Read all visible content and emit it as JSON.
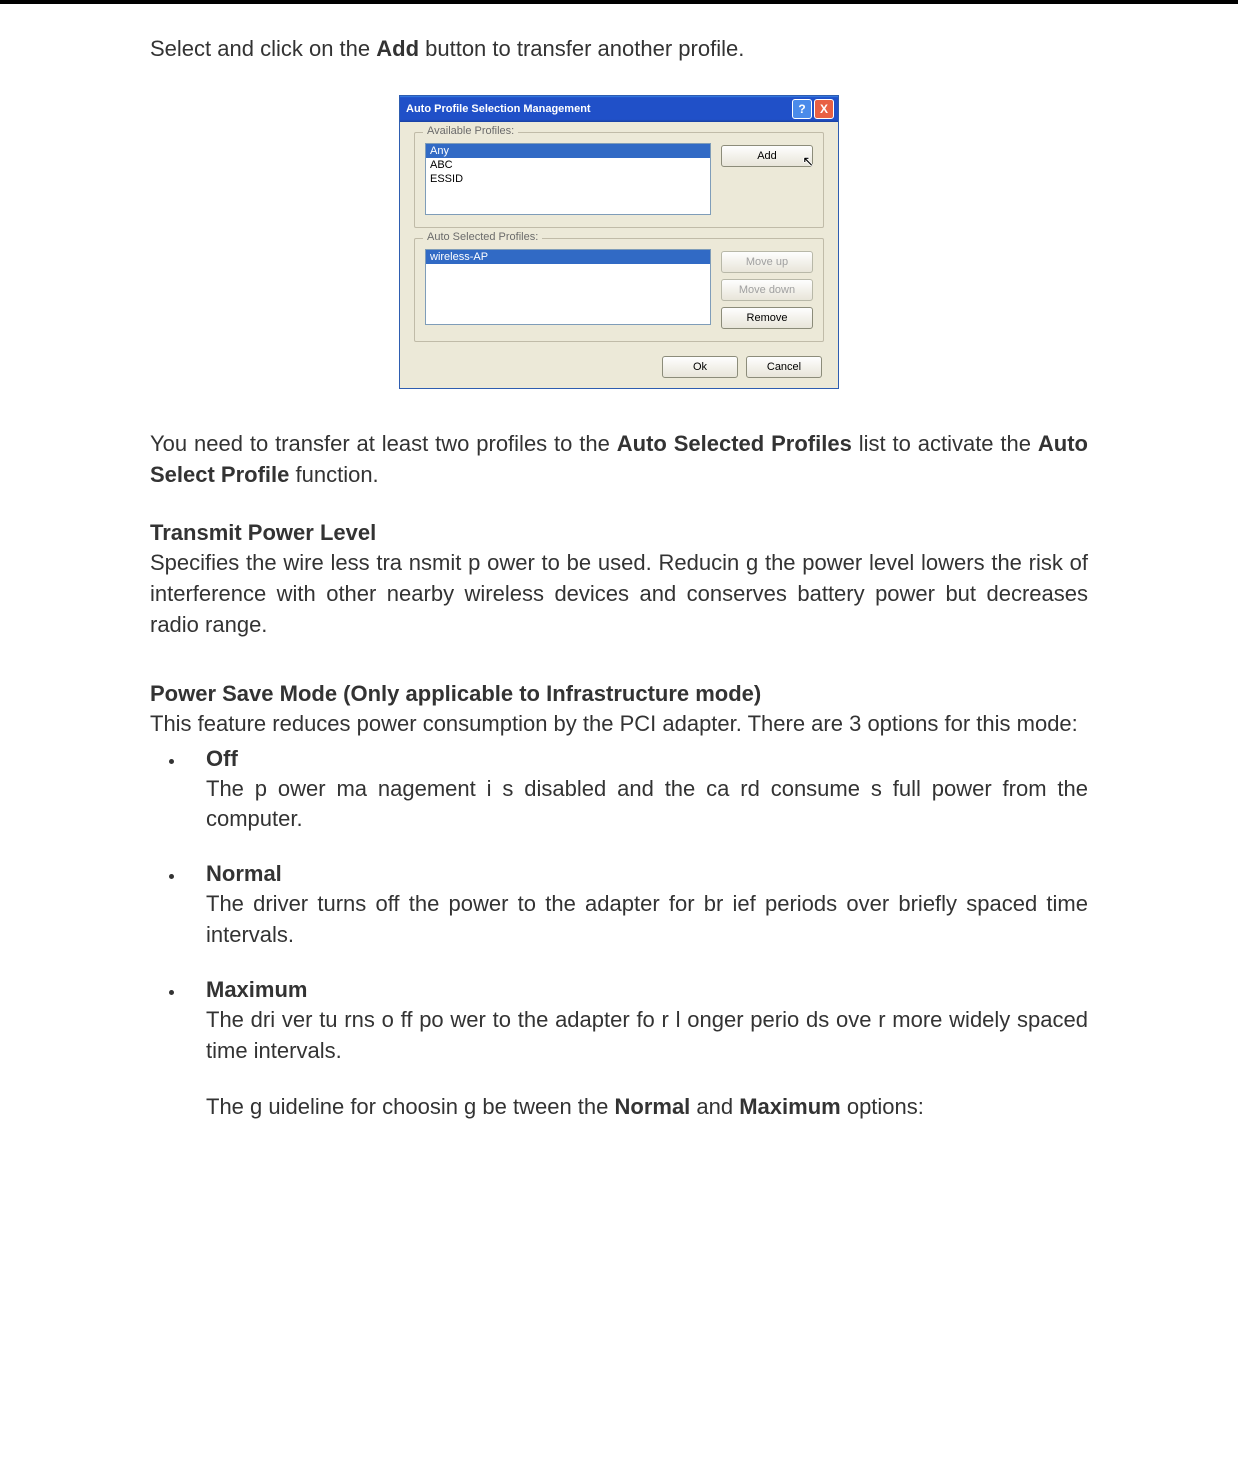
{
  "intro": {
    "pre": "Select and click on the ",
    "add_word": "Add",
    "post": " button to transfer another profile."
  },
  "dialog": {
    "title": "Auto Profile Selection Management",
    "help_glyph": "?",
    "close_glyph": "X",
    "group1_label": "Available Profiles:",
    "available_items": [
      "Any",
      "ABC",
      "ESSID"
    ],
    "add_btn": "Add",
    "cursor_glyph": "↖",
    "group2_label": "Auto Selected Profiles:",
    "selected_items": [
      "wireless-AP"
    ],
    "moveup_btn": "Move up",
    "movedown_btn": "Move down",
    "remove_btn": "Remove",
    "ok_btn": "Ok",
    "cancel_btn": "Cancel"
  },
  "note": {
    "pre": "You need to transfer at  least two profiles to the  ",
    "b1": "Auto Selected Profiles",
    "mid": " list to activate the ",
    "b2": "Auto Select Profile",
    "post": " function."
  },
  "tpl": {
    "heading": "Transmit Power Level",
    "body": "Specifies the wire less tra nsmit p ower to be used.   Reducin g the  power level lowers the risk of interference with other nearby wireless devices and conserves battery power but decreases radio range."
  },
  "psm": {
    "heading": "Power Save Mode (Only applicable to Infrastructure mode)",
    "intro": "This feature reduces power consumption by the PCI adapter. There are 3 options for this mode:",
    "off_title": "Off",
    "off_body": "The p ower ma nagement i s  disabled and the ca  rd consume s full power from the computer.",
    "normal_title": "Normal",
    "normal_body": "The driver turns off the power to  the adapter for br ief periods over briefly spaced time intervals.",
    "max_title": "Maximum",
    "max_body": "The dri ver tu rns o ff po wer to  the  adapter fo r l onger perio ds ove r more widely spaced time intervals.",
    "guide_pre": "The g uideline for choosin  g be tween the   ",
    "guide_b1": "Normal",
    "guide_mid": " and   ",
    "guide_b2": "Maximum",
    "guide_post": " options:"
  }
}
